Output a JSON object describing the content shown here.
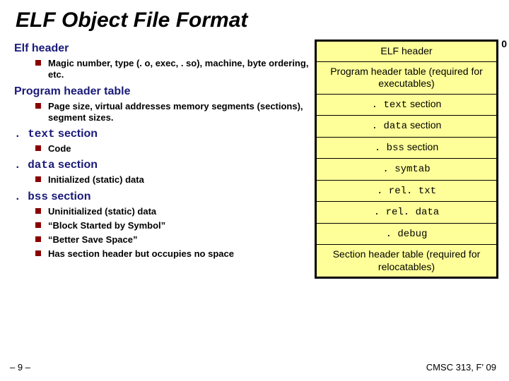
{
  "title": "ELF Object File Format",
  "left": {
    "sec1": {
      "head": "Elf header",
      "items": [
        "Magic number, type (. o, exec, . so), machine, byte ordering, etc."
      ]
    },
    "sec2": {
      "head": "Program header table",
      "items": [
        "Page size, virtual addresses memory segments (sections), segment sizes."
      ]
    },
    "sec3": {
      "head_code": ". text",
      "head_tail": " section",
      "items": [
        "Code"
      ]
    },
    "sec4": {
      "head_code": ". data",
      "head_tail": " section",
      "items": [
        "Initialized (static) data"
      ]
    },
    "sec5": {
      "head_code": ". bss",
      "head_tail": " section",
      "items": [
        "Uninitialized (static) data",
        "“Block Started by Symbol”",
        "“Better Save Space”",
        "Has section header but occupies no space"
      ]
    }
  },
  "diagram": {
    "zero": "0",
    "rows": [
      {
        "text": "ELF header"
      },
      {
        "text": "Program header table (required for executables)"
      },
      {
        "pre": ". text",
        "post": " section"
      },
      {
        "pre": ". data",
        "post": " section"
      },
      {
        "pre": ". bss",
        "post": " section"
      },
      {
        "mono": ". symtab"
      },
      {
        "mono": ". rel. txt"
      },
      {
        "mono": ". rel. data"
      },
      {
        "mono": ". debug"
      },
      {
        "text": "Section header table (required for relocatables)"
      }
    ]
  },
  "footer": {
    "left": "– 9 –",
    "right": "CMSC 313, F' 09"
  }
}
